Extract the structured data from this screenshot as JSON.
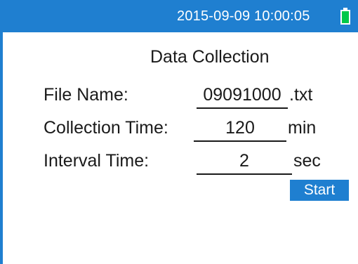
{
  "status_bar": {
    "datetime": "2015-09-09 10:00:05",
    "battery_icon": "battery-full-icon",
    "battery_color": "#00c84a",
    "bar_color": "#1f7fd0"
  },
  "title": "Data Collection",
  "form": {
    "file_name": {
      "label": "File Name:",
      "value": "09091000",
      "unit": ".txt"
    },
    "collection_time": {
      "label": "Collection Time:",
      "value": "120",
      "unit": "min"
    },
    "interval_time": {
      "label": "Interval Time:",
      "value": "2",
      "unit": "sec"
    }
  },
  "start_button_label": "Start"
}
